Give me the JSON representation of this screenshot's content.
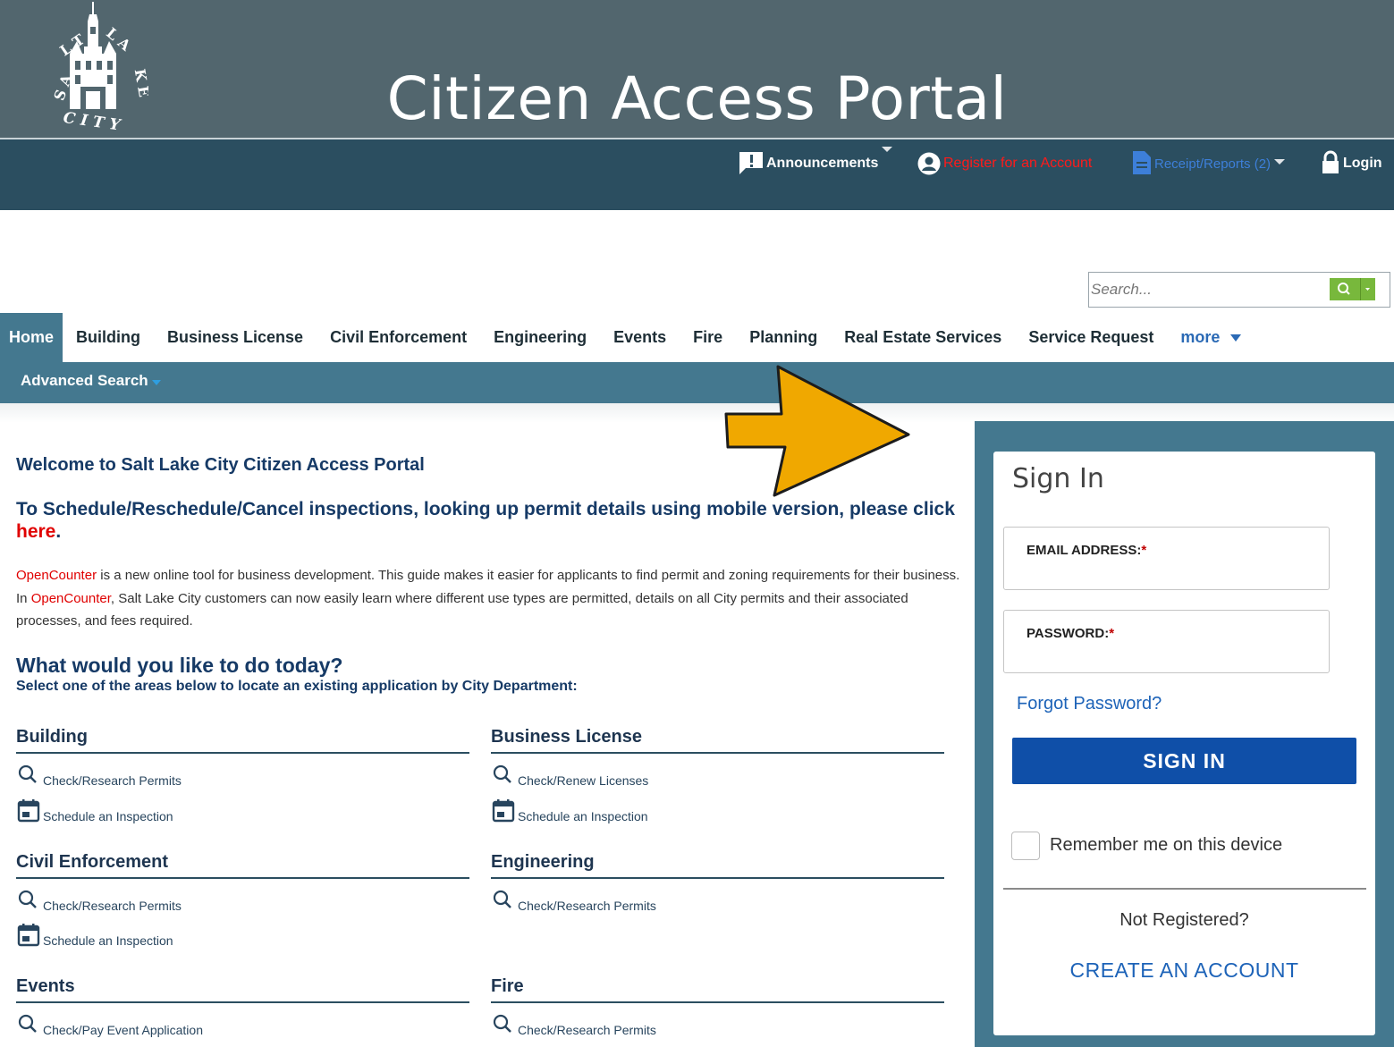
{
  "header": {
    "title": "Citizen Access Portal",
    "logo_text": "SALT LAKE CITY",
    "logo_icon": "city-hall-seal-icon"
  },
  "utility_nav": {
    "announcements": "Announcements",
    "register": "Register for an Account",
    "receipts": "Receipt/Reports (2)",
    "login": "Login"
  },
  "search": {
    "placeholder": "Search..."
  },
  "tabs": [
    {
      "label": "Home",
      "active": true
    },
    {
      "label": "Building"
    },
    {
      "label": "Business License"
    },
    {
      "label": "Civil Enforcement"
    },
    {
      "label": "Engineering"
    },
    {
      "label": "Events"
    },
    {
      "label": "Fire"
    },
    {
      "label": "Planning"
    },
    {
      "label": "Real Estate Services"
    },
    {
      "label": "Service Request"
    },
    {
      "label": "more"
    }
  ],
  "subnav": {
    "advanced_search": "Advanced Search"
  },
  "main": {
    "welcome": "Welcome to Salt Lake City Citizen Access Portal",
    "schedule_text": "To Schedule/Reschedule/Cancel inspections, looking up permit details using mobile version, please click ",
    "schedule_link": "here",
    "schedule_end": ".",
    "opencounter": "OpenCounter",
    "para_1": " is a new online tool for business development. This guide makes it easier for applicants to find permit and zoning requirements for their business. In ",
    "para_2": ", Salt Lake City customers can now easily learn where different use types are permitted, details on all City permits and their associated processes, and fees required.",
    "what_title": "What would you like to do today?",
    "select_text": "Select one of the areas below to locate an existing application by City Department:"
  },
  "departments": [
    {
      "name": "Building",
      "links": [
        "Check/Research Permits",
        "Schedule an Inspection"
      ]
    },
    {
      "name": "Business License",
      "links": [
        "Check/Renew Licenses",
        "Schedule an Inspection"
      ]
    },
    {
      "name": "Civil Enforcement",
      "links": [
        "Check/Research Permits",
        "Schedule an Inspection"
      ]
    },
    {
      "name": "Engineering",
      "links": [
        "Check/Research Permits"
      ]
    },
    {
      "name": "Events",
      "links": [
        "Check/Pay Event Application"
      ]
    },
    {
      "name": "Fire",
      "links": [
        "Check/Research Permits"
      ]
    }
  ],
  "signin": {
    "title": "Sign In",
    "email_label": "EMAIL ADDRESS:",
    "password_label": "PASSWORD:",
    "required_mark": "*",
    "forgot": "Forgot Password?",
    "button": "SIGN IN",
    "remember": "Remember me on this device",
    "not_registered": "Not Registered?",
    "create_account": "CREATE AN ACCOUNT"
  },
  "colors": {
    "banner": "#52666e",
    "utility_bar": "#2b4e60",
    "nav_accent": "#44788f",
    "heading_blue": "#163a66",
    "link_red": "#e00000",
    "signin_button": "#0f4fa8",
    "search_button": "#78b83c",
    "annotation_arrow": "#f0a800"
  }
}
